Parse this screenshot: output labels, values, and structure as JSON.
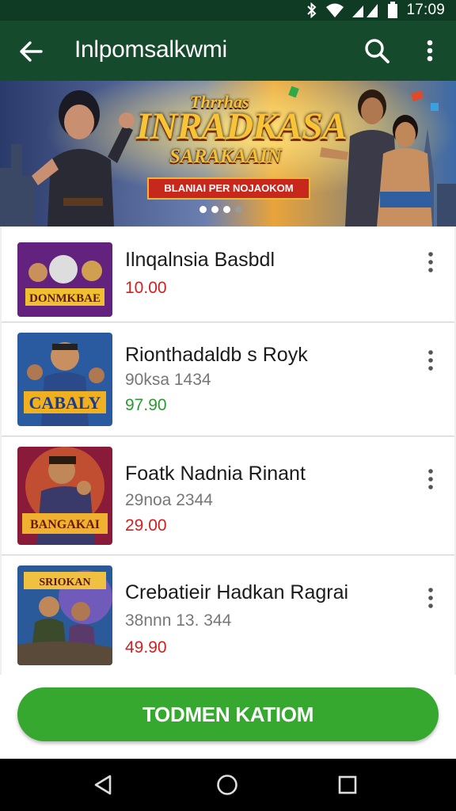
{
  "status_bar": {
    "time": "17:09"
  },
  "app_bar": {
    "title": "Inlpomsalkwmi"
  },
  "banner": {
    "line1": "Thrrhas",
    "line2": "INRADKASA",
    "line3": "SARAKAAIN",
    "ribbon": "BLANIAI PER NOJAOKOM",
    "page_count": 4,
    "active_page": 1
  },
  "apps": [
    {
      "name": "Ilnqalnsia Basbdl",
      "subtitle": "",
      "price": "10.00",
      "price_color": "#d21f1f",
      "thumb_text": "DONMKBAE"
    },
    {
      "name": "Rionthadaldb s Royk",
      "subtitle": "90ksa 1434",
      "price": "97.90",
      "price_color": "#2b9a33",
      "thumb_text": "CABALY"
    },
    {
      "name": "Foatk Nadnia Rinant",
      "subtitle": "29noa 2344",
      "price": "29.00",
      "price_color": "#d21f1f",
      "thumb_text": "BANGAKAI"
    },
    {
      "name": "Crebatieir Hadkan Ragrai",
      "subtitle": "38nnn 13. 344",
      "price": "49.90",
      "price_color": "#d21f1f",
      "thumb_text": "SRIOKAN"
    }
  ],
  "cta": {
    "label": "TODMEN KATIOM"
  },
  "colors": {
    "status_bar": "#0f3a24",
    "app_bar": "#164a2d",
    "cta": "#36a82f"
  },
  "icons": [
    "back-arrow-icon",
    "search-icon",
    "more-vert-icon",
    "nav-back-icon",
    "nav-home-icon",
    "nav-recents-icon"
  ]
}
